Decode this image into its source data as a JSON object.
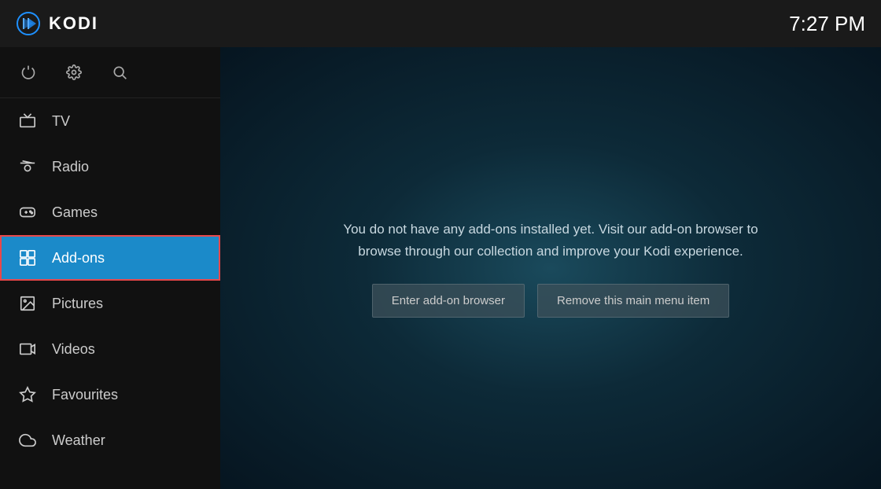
{
  "header": {
    "title": "KODI",
    "time": "7:27 PM"
  },
  "sidebar": {
    "icons": [
      {
        "name": "power-icon",
        "symbol": "⏻"
      },
      {
        "name": "settings-icon",
        "symbol": "⚙"
      },
      {
        "name": "search-icon",
        "symbol": "🔍"
      }
    ],
    "nav_items": [
      {
        "id": "tv",
        "label": "TV",
        "icon": "tv-icon",
        "active": false
      },
      {
        "id": "radio",
        "label": "Radio",
        "icon": "radio-icon",
        "active": false
      },
      {
        "id": "games",
        "label": "Games",
        "icon": "games-icon",
        "active": false
      },
      {
        "id": "addons",
        "label": "Add-ons",
        "icon": "addons-icon",
        "active": true
      },
      {
        "id": "pictures",
        "label": "Pictures",
        "icon": "pictures-icon",
        "active": false
      },
      {
        "id": "videos",
        "label": "Videos",
        "icon": "videos-icon",
        "active": false
      },
      {
        "id": "favourites",
        "label": "Favourites",
        "icon": "favourites-icon",
        "active": false
      },
      {
        "id": "weather",
        "label": "Weather",
        "icon": "weather-icon",
        "active": false
      }
    ]
  },
  "content": {
    "message": "You do not have any add-ons installed yet. Visit our add-on browser to browse through our collection and improve your Kodi experience.",
    "buttons": [
      {
        "id": "enter-addon-browser",
        "label": "Enter add-on browser"
      },
      {
        "id": "remove-menu-item",
        "label": "Remove this main menu item"
      }
    ]
  }
}
